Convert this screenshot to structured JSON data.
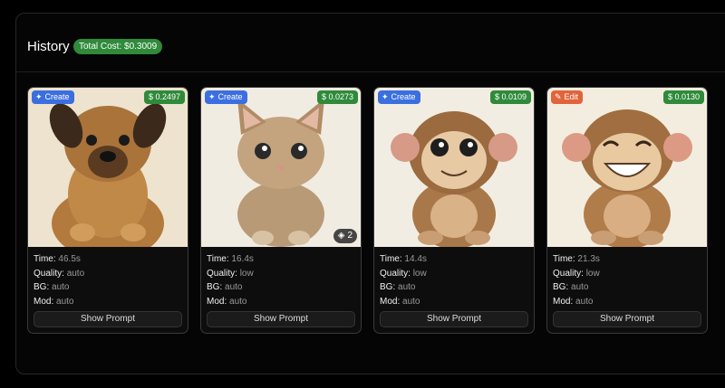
{
  "history": {
    "title": "History",
    "total_cost": "Total Cost: $0.3009"
  },
  "labels": {
    "time": "Time:",
    "quality": "Quality:",
    "bg": "BG:",
    "mod": "Mod:"
  },
  "cards": [
    {
      "type": "Create",
      "type_icon": "sparkle-icon",
      "price": "0.2497",
      "time": "46.5s",
      "quality": "auto",
      "bg": "auto",
      "mod": "auto",
      "button": "Show Prompt",
      "subject": "puppy"
    },
    {
      "type": "Create",
      "type_icon": "sparkle-icon",
      "price": "0.0273",
      "time": "16.4s",
      "quality": "low",
      "bg": "auto",
      "mod": "auto",
      "button": "Show Prompt",
      "subject": "kitten",
      "layers": "2"
    },
    {
      "type": "Create",
      "type_icon": "sparkle-icon",
      "price": "0.0109",
      "time": "14.4s",
      "quality": "low",
      "bg": "auto",
      "mod": "auto",
      "button": "Show Prompt",
      "subject": "monkey"
    },
    {
      "type": "Edit",
      "type_icon": "pencil-icon",
      "price": "0.0130",
      "time": "21.3s",
      "quality": "low",
      "bg": "auto",
      "mod": "auto",
      "button": "Show Prompt",
      "subject": "laughing-monkey"
    }
  ],
  "colors": {
    "create": "#3b6fe0",
    "edit": "#e0653b",
    "price": "#2f8a3a"
  }
}
